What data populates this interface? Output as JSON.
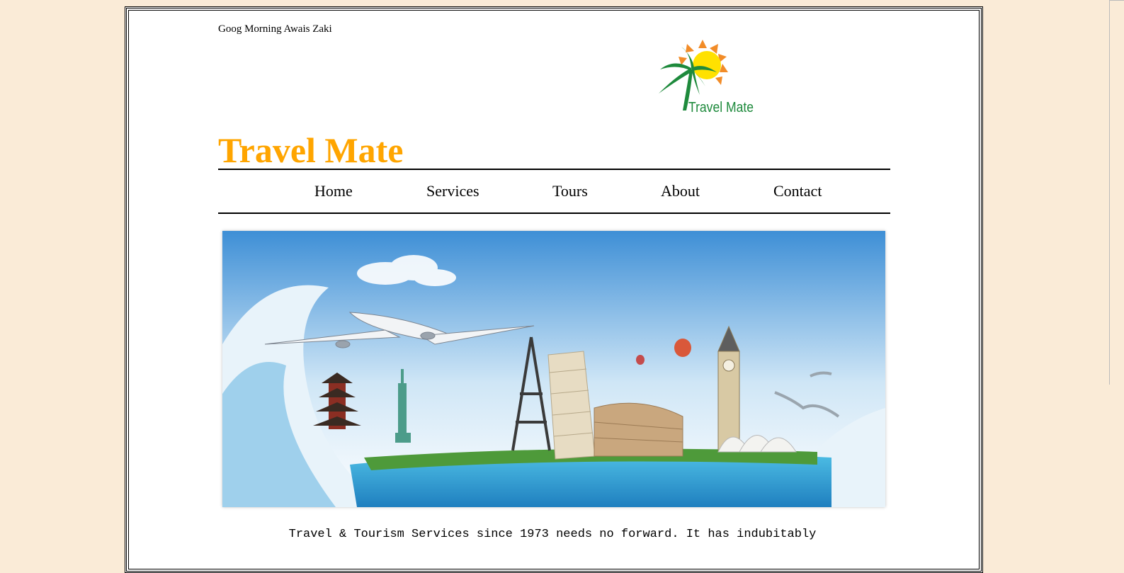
{
  "header": {
    "greeting": "Goog Morning Awais Zaki",
    "logo_text": "Travel Mate",
    "site_title": "Travel Mate"
  },
  "nav": {
    "items": [
      "Home",
      "Services",
      "Tours",
      "About",
      "Contact"
    ]
  },
  "intro": {
    "text": "Travel & Tourism Services since 1973 needs no forward. It has indubitably"
  },
  "colors": {
    "page_background": "#FAEBD7",
    "title_orange": "#FFA500",
    "logo_green": "#1E8A3C",
    "sun_yellow": "#FFE100",
    "sun_orange": "#F28C28"
  }
}
